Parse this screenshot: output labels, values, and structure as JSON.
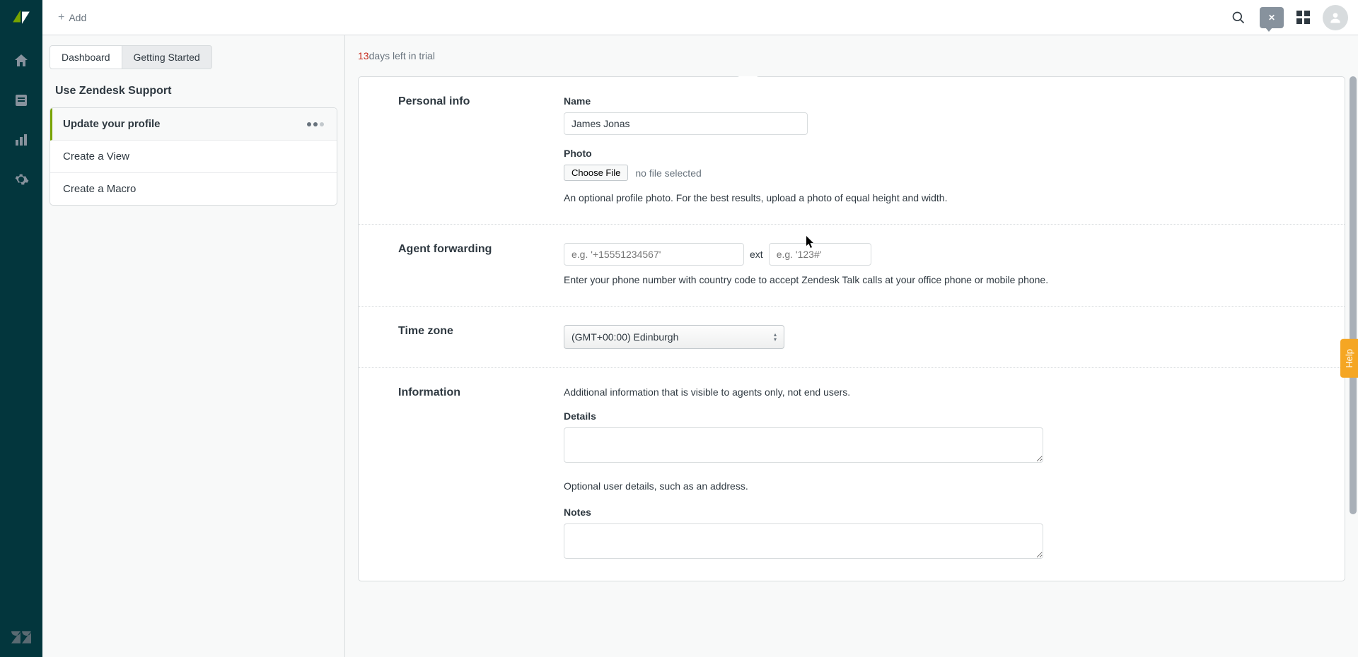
{
  "topbar": {
    "add_label": "Add"
  },
  "trial": {
    "days": "13",
    "text": " days left in trial"
  },
  "tabs": {
    "dashboard": "Dashboard",
    "getting_started": "Getting Started"
  },
  "sidebar": {
    "section_title": "Use Zendesk Support",
    "steps": [
      {
        "label": "Update your profile"
      },
      {
        "label": "Create a View"
      },
      {
        "label": "Create a Macro"
      }
    ]
  },
  "form": {
    "personal_info": {
      "title": "Personal info",
      "name_label": "Name",
      "name_value": "James Jonas",
      "photo_label": "Photo",
      "choose_file": "Choose File",
      "file_status": "no file selected",
      "photo_help": "An optional profile photo. For the best results, upload a photo of equal height and width."
    },
    "agent_forwarding": {
      "title": "Agent forwarding",
      "phone_placeholder": "e.g. '+15551234567'",
      "ext_label": "ext",
      "ext_placeholder": "e.g. '123#'",
      "help": "Enter your phone number with country code to accept Zendesk Talk calls at your office phone or mobile phone."
    },
    "timezone": {
      "title": "Time zone",
      "value": "(GMT+00:00) Edinburgh"
    },
    "information": {
      "title": "Information",
      "desc": "Additional information that is visible to agents only, not end users.",
      "details_label": "Details",
      "details_help": "Optional user details, such as an address.",
      "notes_label": "Notes"
    }
  },
  "help_tab": "Help"
}
